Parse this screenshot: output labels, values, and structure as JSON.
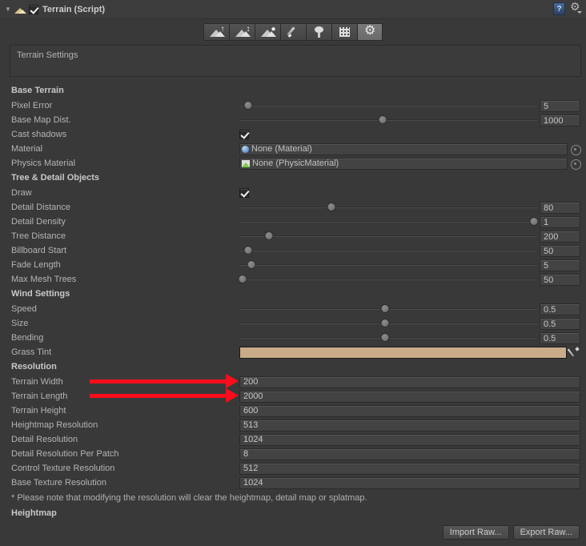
{
  "header": {
    "foldout_glyph": "▼",
    "title": "Terrain (Script)",
    "enabled_checkbox": true,
    "help_glyph": "?"
  },
  "toolbar": {
    "buttons": [
      {
        "name": "raise-lower-terrain",
        "icon": "terrain-raise-icon",
        "active": false
      },
      {
        "name": "paint-height",
        "icon": "terrain-height-icon",
        "active": false
      },
      {
        "name": "smooth-height",
        "icon": "terrain-smooth-icon",
        "active": false
      },
      {
        "name": "paint-texture",
        "icon": "brush-icon",
        "active": false
      },
      {
        "name": "place-trees",
        "icon": "tree-icon",
        "active": false
      },
      {
        "name": "paint-details",
        "icon": "grass-icon",
        "active": false
      },
      {
        "name": "terrain-settings",
        "icon": "gear-icon",
        "active": true
      }
    ]
  },
  "helpbox": {
    "text": "Terrain Settings"
  },
  "sections": {
    "base_terrain": {
      "title": "Base Terrain",
      "rows": [
        {
          "label": "Pixel Error",
          "type": "slider",
          "value": "5",
          "knob_pct": 3
        },
        {
          "label": "Base Map Dist.",
          "type": "slider",
          "value": "1000",
          "knob_pct": 48
        },
        {
          "label": "Cast shadows",
          "type": "checkbox",
          "checked": true
        },
        {
          "label": "Material",
          "type": "object",
          "value": "None (Material)",
          "icon": "material-sphere-icon"
        },
        {
          "label": "Physics Material",
          "type": "object",
          "value": "None (PhysicMaterial)",
          "icon": "physic-material-icon"
        }
      ]
    },
    "tree_detail": {
      "title": "Tree & Detail Objects",
      "rows": [
        {
          "label": "Draw",
          "type": "checkbox",
          "checked": true
        },
        {
          "label": "Detail Distance",
          "type": "slider",
          "value": "80",
          "knob_pct": 31
        },
        {
          "label": "Detail Density",
          "type": "slider",
          "value": "1",
          "knob_pct": 99
        },
        {
          "label": "Tree Distance",
          "type": "slider",
          "value": "200",
          "knob_pct": 10
        },
        {
          "label": "Billboard Start",
          "type": "slider",
          "value": "50",
          "knob_pct": 3
        },
        {
          "label": "Fade Length",
          "type": "slider",
          "value": "5",
          "knob_pct": 4
        },
        {
          "label": "Max Mesh Trees",
          "type": "slider",
          "value": "50",
          "knob_pct": 1
        }
      ]
    },
    "wind_settings": {
      "title": "Wind Settings",
      "rows": [
        {
          "label": "Speed",
          "type": "slider",
          "value": "0.5",
          "knob_pct": 49
        },
        {
          "label": "Size",
          "type": "slider",
          "value": "0.5",
          "knob_pct": 49
        },
        {
          "label": "Bending",
          "type": "slider",
          "value": "0.5",
          "knob_pct": 49
        },
        {
          "label": "Grass Tint",
          "type": "color",
          "color": "#c9ab8a"
        }
      ]
    },
    "resolution": {
      "title": "Resolution",
      "rows": [
        {
          "label": "Terrain Width",
          "value": "200"
        },
        {
          "label": "Terrain Length",
          "value": "2000"
        },
        {
          "label": "Terrain Height",
          "value": "600"
        },
        {
          "label": "Heightmap Resolution",
          "value": "513"
        },
        {
          "label": "Detail Resolution",
          "value": "1024"
        },
        {
          "label": "Detail Resolution Per Patch",
          "value": "8"
        },
        {
          "label": "Control Texture Resolution",
          "value": "512"
        },
        {
          "label": "Base Texture Resolution",
          "value": "1024"
        }
      ],
      "note": "* Please note that modifying the resolution will clear the heightmap, detail map or splatmap."
    },
    "heightmap": {
      "title": "Heightmap",
      "import_label": "Import Raw...",
      "export_label": "Export Raw..."
    }
  },
  "annotations": {
    "accent_color": "#fc0d1b",
    "arrows": [
      {
        "name": "arrow-terrain-width",
        "target": "Terrain Width"
      },
      {
        "name": "arrow-terrain-length",
        "target": "Terrain Length"
      }
    ]
  }
}
